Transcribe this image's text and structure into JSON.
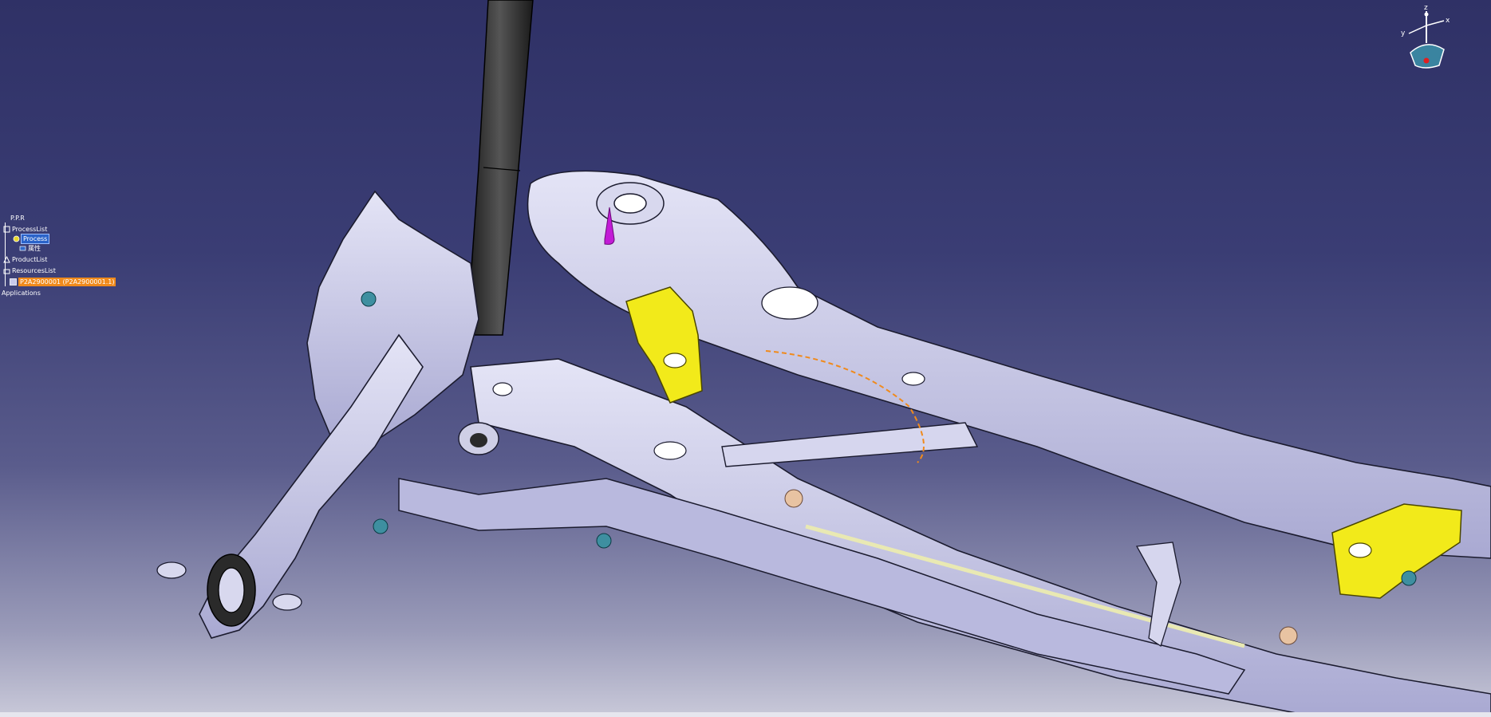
{
  "tree": {
    "root_label": "P.P.R",
    "process_list_label": "ProcessList",
    "process_label": "Process",
    "property_label": "属性",
    "product_list_label": "ProductList",
    "resources_list_label": "ResourcesList",
    "resource_item_label": "P2A2900001 (P2A2900001.1)",
    "applications_label": "Applications"
  },
  "compass": {
    "z_label": "z",
    "x_label": "x",
    "y_label": "y"
  },
  "colors": {
    "background_top": "#2f3166",
    "background_bottom": "#c9c9d9",
    "part_body": "#c9c9ea",
    "bracket_yellow": "#f2ea1a",
    "selection_orange": "#f08a1c",
    "selection_blue": "#2b63c9",
    "shock_absorber": "#2c2c2c",
    "pin_magenta": "#c21bd6",
    "compass_red": "#e02020"
  },
  "icons": [
    "tree-root-icon",
    "process-list-icon",
    "process-icon",
    "property-icon",
    "product-list-icon",
    "resources-list-icon",
    "resource-item-icon",
    "compass-icon"
  ]
}
